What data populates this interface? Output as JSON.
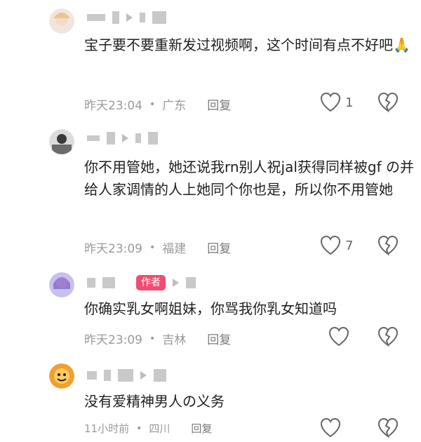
{
  "comments": [
    {
      "text": "宝子要不要重新发过视频啊，这个时间有点不好吧🙏",
      "time": "昨天23:04",
      "location": "广东",
      "reply_label": "回复",
      "likes": "1"
    },
    {
      "text": "你不用管她，她还说我rn别人祝jal获得同样被gf の并给人家调情的人上她同个你也是，所以你不用管她",
      "time": "昨天23:09",
      "location": "福建",
      "reply_label": "回复",
      "likes": "7"
    },
    {
      "badge": "作者",
      "text": "你确实乳女啊姐妹，你骂我你乳女知道吗",
      "time": "昨天23:09",
      "location": "吉林",
      "reply_label": "回复"
    },
    {
      "text": "没有爱精神男人の义务",
      "time": "11小时前",
      "location": "四川",
      "reply_label": "回复"
    }
  ],
  "separator": "•"
}
